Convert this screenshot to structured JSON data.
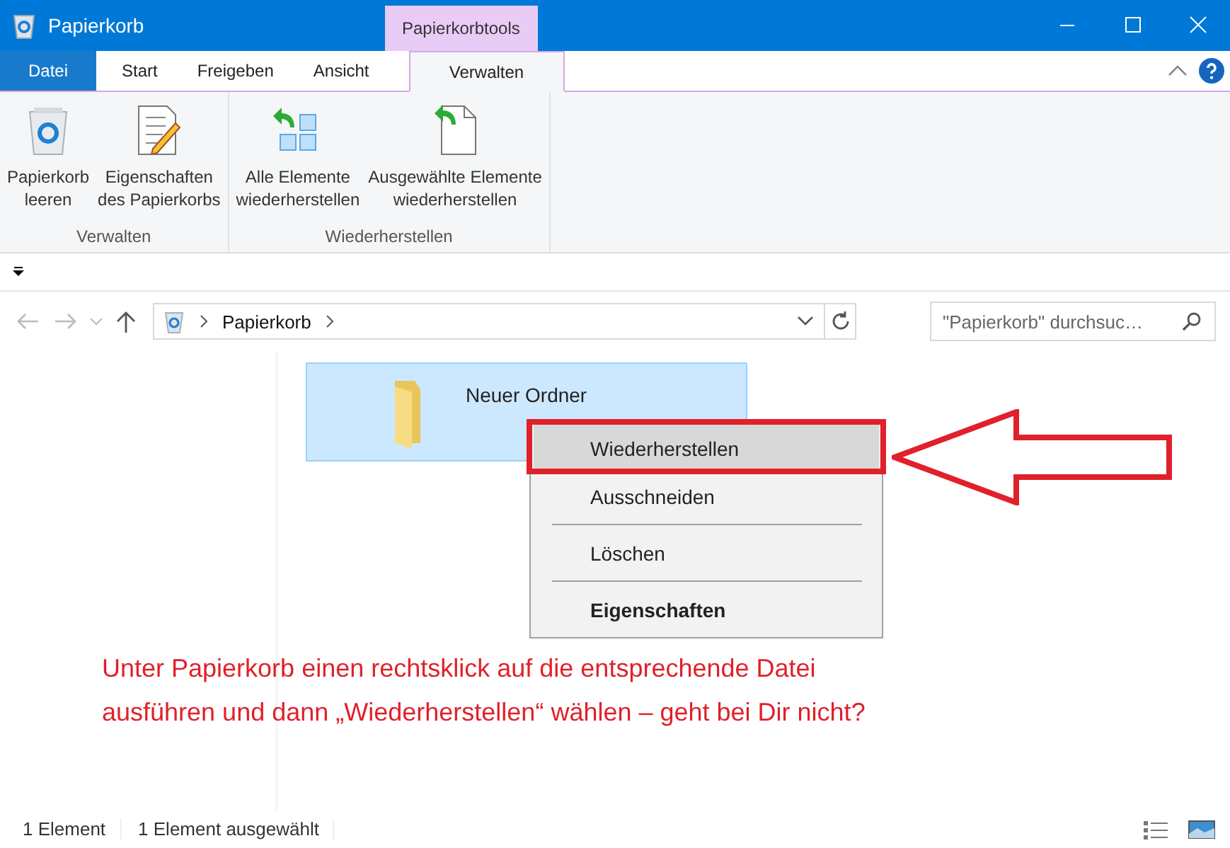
{
  "window": {
    "title": "Papierkorb",
    "contextual_tab_group": "Papierkorbtools"
  },
  "tabs": [
    {
      "label": "Datei",
      "kind": "file",
      "selected": false
    },
    {
      "label": "Start",
      "kind": "tab",
      "selected": false
    },
    {
      "label": "Freigeben",
      "kind": "tab",
      "selected": false
    },
    {
      "label": "Ansicht",
      "kind": "tab",
      "selected": false
    },
    {
      "label": "Verwalten",
      "kind": "contextual",
      "selected": true
    }
  ],
  "ribbon": {
    "groups": [
      {
        "label": "Verwalten",
        "buttons": [
          {
            "kind": "bin",
            "lines": [
              "Papierkorb",
              "leeren"
            ]
          },
          {
            "kind": "properties",
            "lines": [
              "Eigenschaften",
              "des Papierkorbs"
            ]
          }
        ]
      },
      {
        "label": "Wiederherstellen",
        "buttons": [
          {
            "kind": "restore-all",
            "lines": [
              "Alle Elemente",
              "wiederherstellen"
            ]
          },
          {
            "kind": "restore-selected",
            "lines": [
              "Ausgewählte Elemente",
              "wiederherstellen"
            ]
          }
        ]
      }
    ]
  },
  "address": {
    "path": "Papierkorb"
  },
  "search": {
    "placeholder": "\"Papierkorb\" durchsuc…"
  },
  "items": [
    {
      "name": "Neuer Ordner",
      "selected": true
    }
  ],
  "context_menu": [
    {
      "label": "Wiederherstellen",
      "selected": true,
      "default": false,
      "separator_after": false
    },
    {
      "label": "Ausschneiden",
      "selected": false,
      "default": false,
      "separator_after": true
    },
    {
      "label": "Löschen",
      "selected": false,
      "default": false,
      "separator_after": true
    },
    {
      "label": "Eigenschaften",
      "selected": false,
      "default": true,
      "separator_after": false
    }
  ],
  "annotation": {
    "lines": [
      "Unter Papierkorb einen rechtsklick auf die entsprechende Datei",
      "ausführen und dann „Wiederherstellen“ wählen – geht bei Dir nicht?"
    ]
  },
  "status_bar": [
    "1 Element",
    "1 Element ausgewählt"
  ]
}
